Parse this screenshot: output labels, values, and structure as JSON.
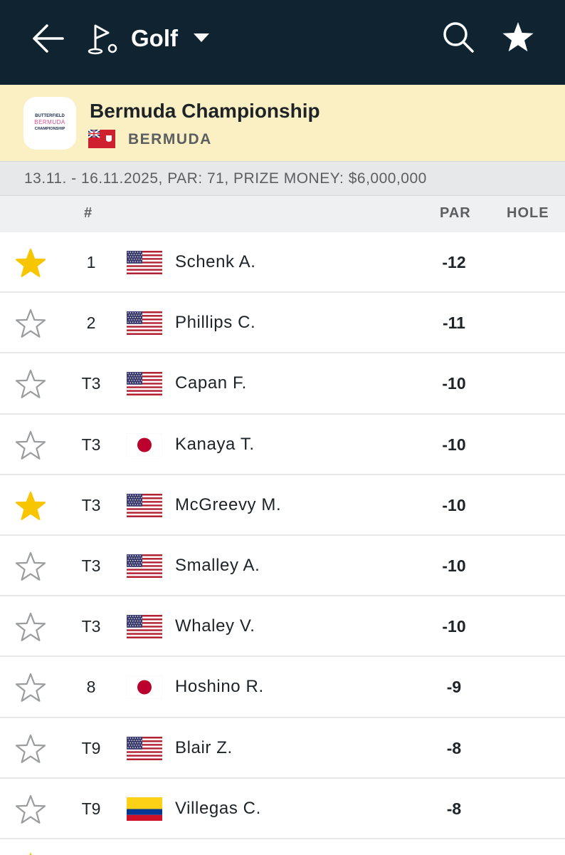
{
  "topbar": {
    "back_icon": "arrow-left-icon",
    "sport_icon": "golf-flag-icon",
    "sport_label": "Golf",
    "dropdown_icon": "caret-down-icon",
    "search_icon": "search-icon",
    "favorites_icon": "star-icon"
  },
  "tournament": {
    "logo_text": [
      "BUTTERFIELD",
      "BERMUDA",
      "CHAMPIONSHIP"
    ],
    "name": "Bermuda Championship",
    "country": "BERMUDA",
    "country_flag": "bermuda-flag-icon",
    "info": "13.11. - 16.11.2025, PAR: 71, PRIZE MONEY: $6,000,000"
  },
  "columns": {
    "rank": "#",
    "par": "PAR",
    "hole": "HOLE"
  },
  "colors": {
    "topbar_bg": "#0f2430",
    "tournament_bg": "#fbefc4",
    "star_active": "#f7c600",
    "star_inactive": "#9a9c9e"
  },
  "rows": [
    {
      "favorite": true,
      "rank": "1",
      "flag": "usa",
      "player": "Schenk A.",
      "par": "-12",
      "hole": ""
    },
    {
      "favorite": false,
      "rank": "2",
      "flag": "usa",
      "player": "Phillips C.",
      "par": "-11",
      "hole": ""
    },
    {
      "favorite": false,
      "rank": "T3",
      "flag": "usa",
      "player": "Capan F.",
      "par": "-10",
      "hole": ""
    },
    {
      "favorite": false,
      "rank": "T3",
      "flag": "jpn",
      "player": "Kanaya T.",
      "par": "-10",
      "hole": ""
    },
    {
      "favorite": true,
      "rank": "T3",
      "flag": "usa",
      "player": "McGreevy M.",
      "par": "-10",
      "hole": ""
    },
    {
      "favorite": false,
      "rank": "T3",
      "flag": "usa",
      "player": "Smalley A.",
      "par": "-10",
      "hole": ""
    },
    {
      "favorite": false,
      "rank": "T3",
      "flag": "usa",
      "player": "Whaley V.",
      "par": "-10",
      "hole": ""
    },
    {
      "favorite": false,
      "rank": "8",
      "flag": "jpn",
      "player": "Hoshino R.",
      "par": "-9",
      "hole": ""
    },
    {
      "favorite": false,
      "rank": "T9",
      "flag": "usa",
      "player": "Blair Z.",
      "par": "-8",
      "hole": ""
    },
    {
      "favorite": false,
      "rank": "T9",
      "flag": "col",
      "player": "Villegas C.",
      "par": "-8",
      "hole": ""
    }
  ]
}
